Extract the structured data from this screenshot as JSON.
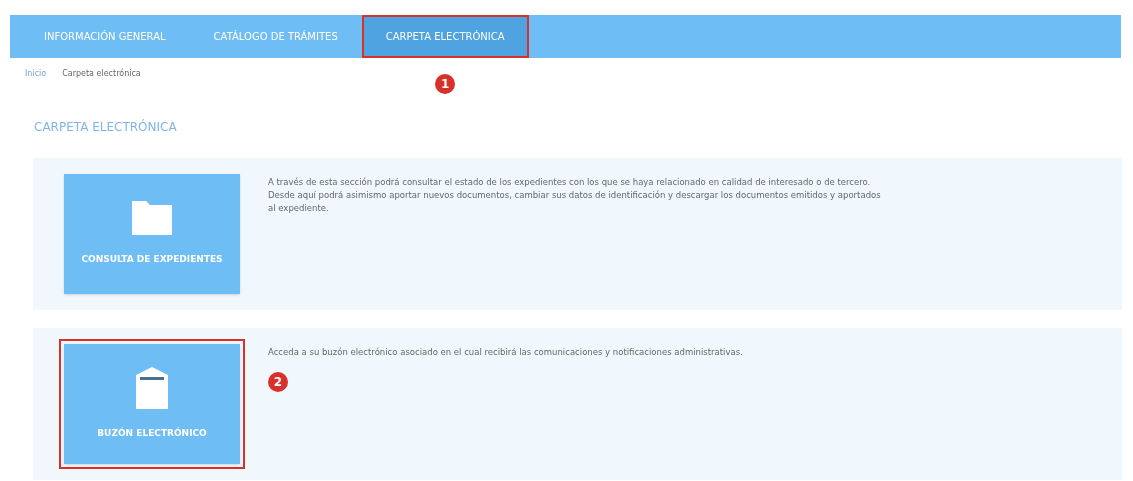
{
  "nav": [
    {
      "label": "INFORMACIÓN GENERAL",
      "selected": false,
      "highlighted": false
    },
    {
      "label": "CATÁLOGO DE TRÁMITES",
      "selected": false,
      "highlighted": false
    },
    {
      "label": "CARPETA ELECTRÓNICA",
      "selected": true,
      "highlighted": true,
      "callout": "1"
    }
  ],
  "breadcrumb": [
    "Inicio",
    "Carpeta electrónica"
  ],
  "title": "CARPETA ELECTRÓNICA",
  "sections": [
    {
      "kind": "folder",
      "tile": "CONSULTA DE EXPEDIENTES",
      "highlighted": false,
      "lines": [
        "A través de esta sección podrá consultar el estado de los expedientes con los que se haya relacionado en calidad de interesado o de tercero.",
        "Desde aquí podrá asimismo aportar nuevos documentos, cambiar sus datos de identificación y descargar los documentos emitidos y aportados",
        "al expediente."
      ]
    },
    {
      "kind": "mailbox",
      "tile": "BUZÓN ELECTRÓNICO",
      "highlighted": true,
      "callout": "2",
      "lines": [
        "Acceda a su buzón electrónico asociado en el cual recibirá las comunicaciones y notificaciones administrativas."
      ]
    }
  ]
}
